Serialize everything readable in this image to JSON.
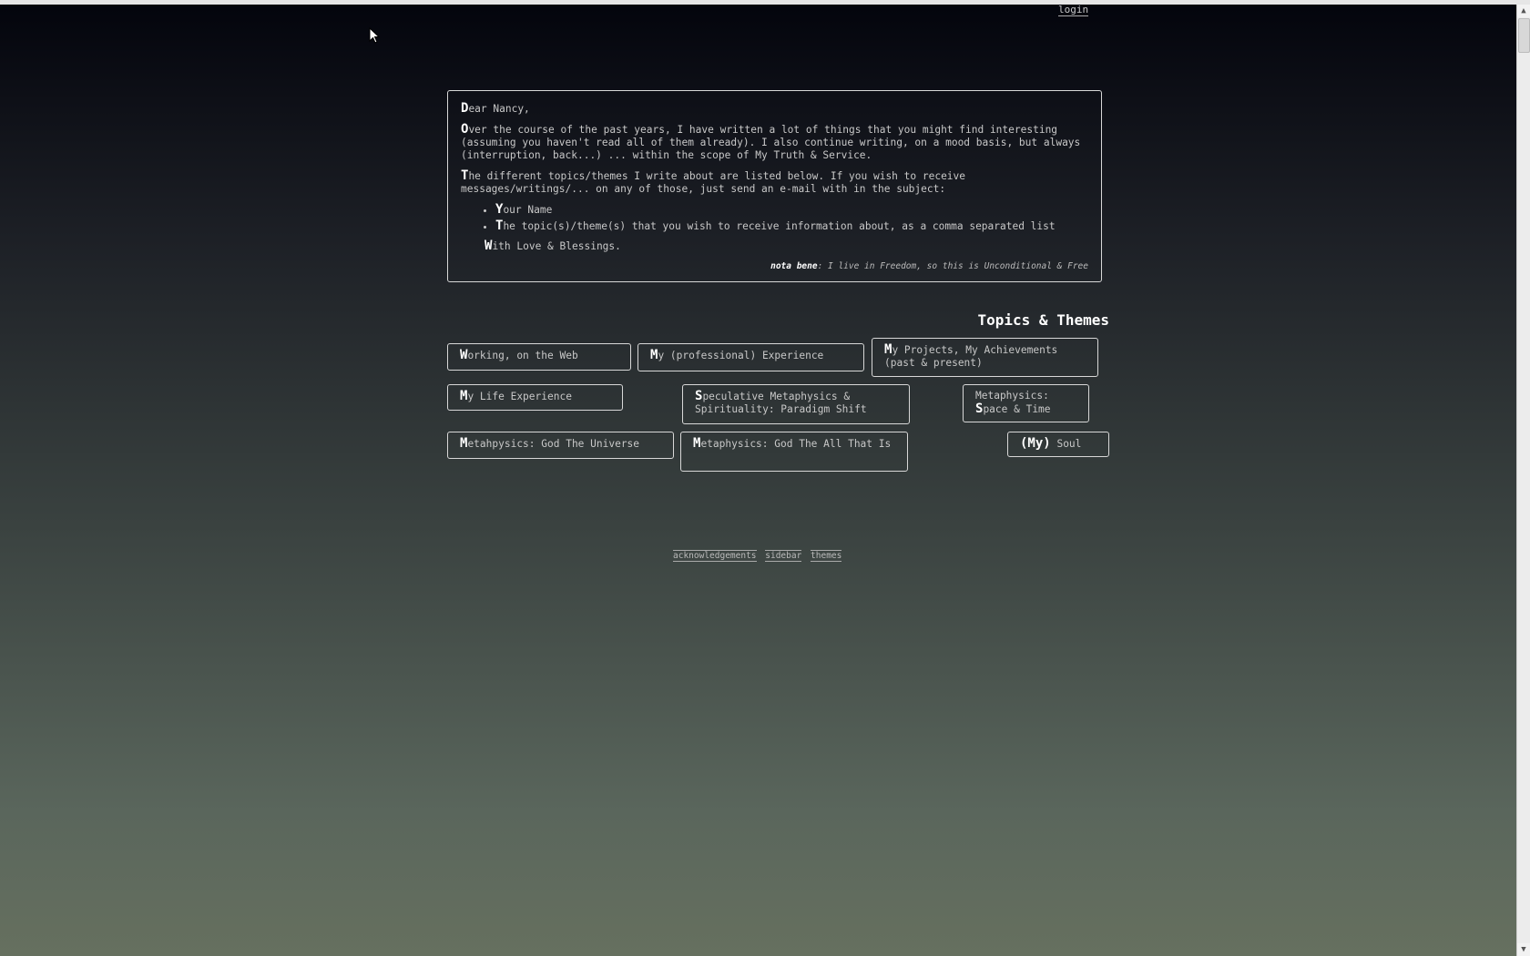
{
  "header": {
    "login_label": "login"
  },
  "letter": {
    "greeting_cap": "D",
    "greeting_rest": "ear Nancy,",
    "para1_cap": "O",
    "para1_rest": "ver the course of the past years, I have written a lot of things that you might find interesting (assuming you haven't read all of them already). I also continue writing, on a mood basis, but always (interruption, back...) ... within the scope of My Truth & Service.",
    "para2_cap": "T",
    "para2_rest": "he different topics/themes I write about are listed below. If you wish to receive messages/writings/... on any of those, just send an e-mail with in the subject:",
    "bullets": [
      {
        "cap": "Y",
        "rest": "our Name"
      },
      {
        "cap": "T",
        "rest": "he topic(s)/theme(s) that you wish to receive information about, as a comma separated list"
      }
    ],
    "closing_cap": "W",
    "closing_rest": "ith Love & Blessings.",
    "nota_label": "nota bene",
    "nota_text": ": I live in Freedom, so this is Unconditional & Free"
  },
  "topics": {
    "title": "Topics & Themes",
    "items": [
      {
        "cap": "W",
        "rest": "orking, on the Web"
      },
      {
        "cap": "M",
        "rest": "y (professional) Experience"
      },
      {
        "cap": "M",
        "rest": "y Projects, My Achievements (past & present)"
      },
      {
        "cap": "M",
        "rest": "y Life Experience"
      },
      {
        "cap": "S",
        "rest": "peculative Metaphysics & Spirituality: Paradigm Shift"
      },
      {
        "pre": "Metaphysics:",
        "cap": "S",
        "rest": "pace & Time"
      },
      {
        "cap": "M",
        "rest": "etahpysics: God The Universe"
      },
      {
        "cap": "M",
        "rest": "etaphysics: God The All That Is"
      },
      {
        "cap": "(My)",
        "rest": " Soul"
      }
    ]
  },
  "footer": {
    "links": [
      "acknowledgements",
      "sidebar",
      "themes"
    ]
  },
  "colors": {
    "text": "#c8c8c8",
    "border": "#d8d8d8",
    "heading": "#ffffff"
  }
}
